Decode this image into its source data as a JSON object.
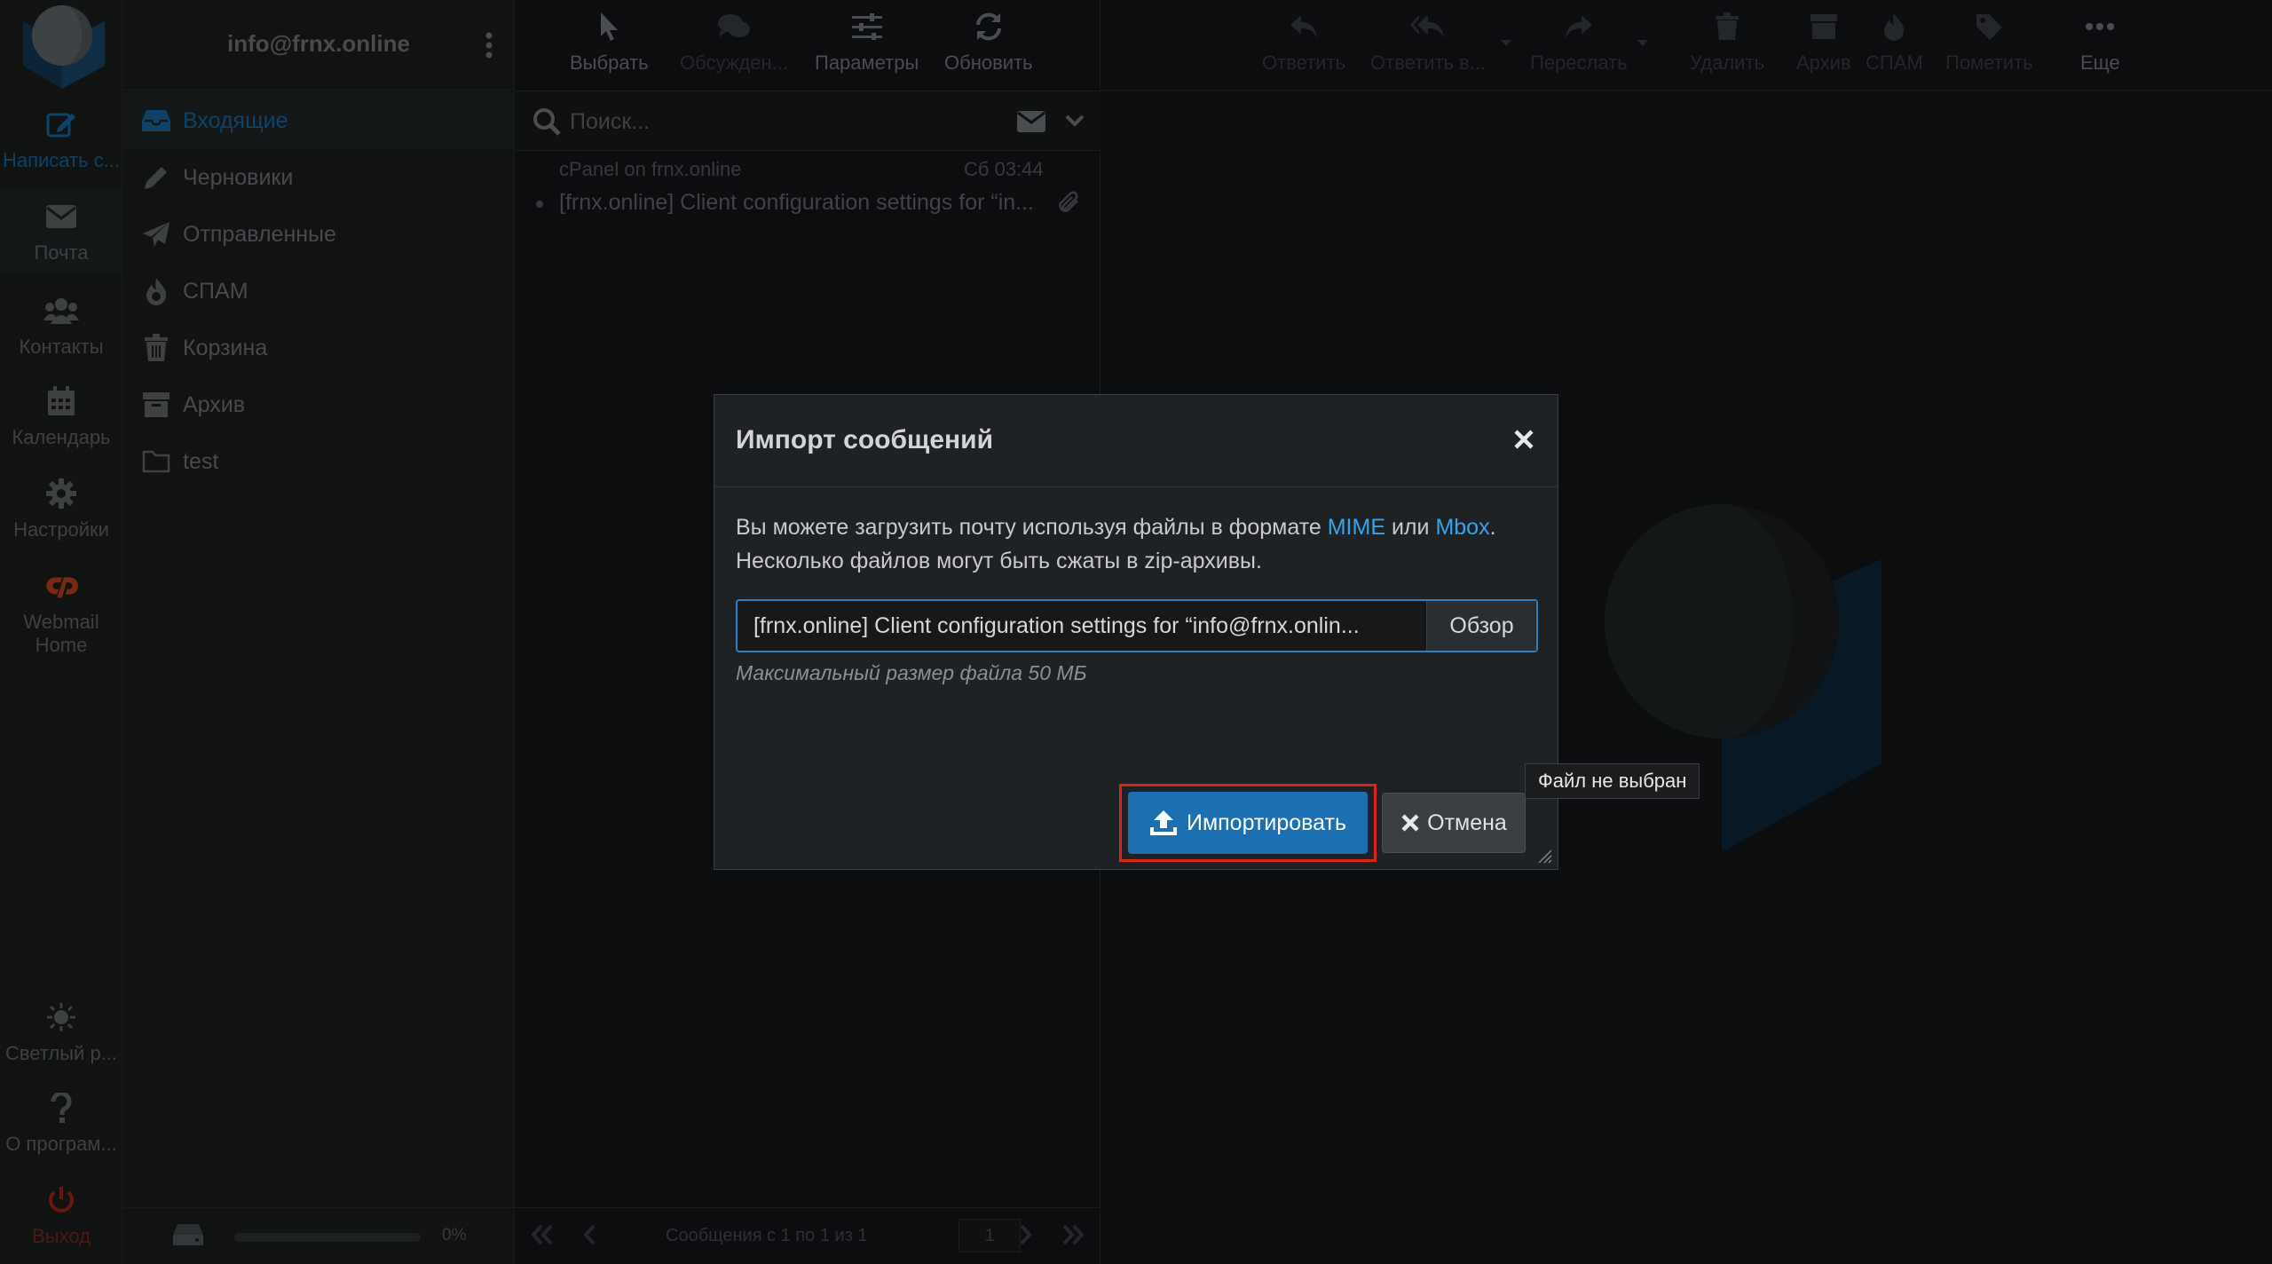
{
  "colors": {
    "accent": "#1a73b0",
    "link": "#38a3e8",
    "highlight_border": "#d9261c",
    "logout": "#8c2a22"
  },
  "nav": {
    "compose": {
      "label": "Написать с...",
      "icon": "compose-icon"
    },
    "mail": {
      "label": "Почта",
      "icon": "envelope-icon"
    },
    "contacts": {
      "label": "Контакты",
      "icon": "contacts-icon"
    },
    "calendar": {
      "label": "Календарь",
      "icon": "calendar-icon"
    },
    "settings": {
      "label": "Настройки",
      "icon": "gear-icon"
    },
    "cpanel": {
      "label_line1": "Webmail",
      "label_line2": "Home",
      "icon": "cpanel-icon"
    },
    "theme": {
      "label": "Светлый р...",
      "icon": "sun-icon"
    },
    "about": {
      "label": "О програм...",
      "icon": "question-icon"
    },
    "logout": {
      "label": "Выход",
      "icon": "power-icon"
    }
  },
  "folders": {
    "account": "info@frnx.online",
    "items": [
      {
        "label": "Входящие",
        "icon": "inbox-icon"
      },
      {
        "label": "Черновики",
        "icon": "pencil-icon"
      },
      {
        "label": "Отправленные",
        "icon": "paper-plane-icon"
      },
      {
        "label": "СПАМ",
        "icon": "fire-icon"
      },
      {
        "label": "Корзина",
        "icon": "trash-icon"
      },
      {
        "label": "Архив",
        "icon": "archive-icon"
      },
      {
        "label": "test",
        "icon": "folder-icon"
      }
    ],
    "quota": "0%"
  },
  "list_toolbar": {
    "select": "Выбрать",
    "threads": "Обсужден...",
    "options": "Параметры",
    "refresh": "Обновить"
  },
  "search": {
    "placeholder": "Поиск..."
  },
  "message": {
    "from": "cPanel on frnx.online",
    "date": "Сб 03:44",
    "subject": "[frnx.online] Client configuration settings for “in..."
  },
  "pagination": {
    "count": "Сообщения с 1 по 1 из 1",
    "page": "1"
  },
  "content_toolbar": {
    "reply": "Ответить",
    "reply_all": "Ответить в...",
    "forward": "Переслать",
    "delete": "Удалить",
    "archive": "Архив",
    "spam": "СПАМ",
    "mark": "Пометить",
    "more": "Еще"
  },
  "dialog": {
    "title": "Импорт сообщений",
    "desc_part1": "Вы можете загрузить почту используя файлы в формате ",
    "link_mime": "MIME",
    "desc_or": " или ",
    "link_mbox": "Mbox",
    "desc_part2": ".",
    "desc_line2": "Несколько файлов могут быть сжаты в zip-архивы.",
    "file_value": "[frnx.online] Client configuration settings for “info@frnx.onlin...",
    "browse": "Обзор",
    "hint": "Максимальный размер файла 50 МБ",
    "import": "Импортировать",
    "cancel": "Отмена"
  },
  "tooltip": "Файл не выбран"
}
